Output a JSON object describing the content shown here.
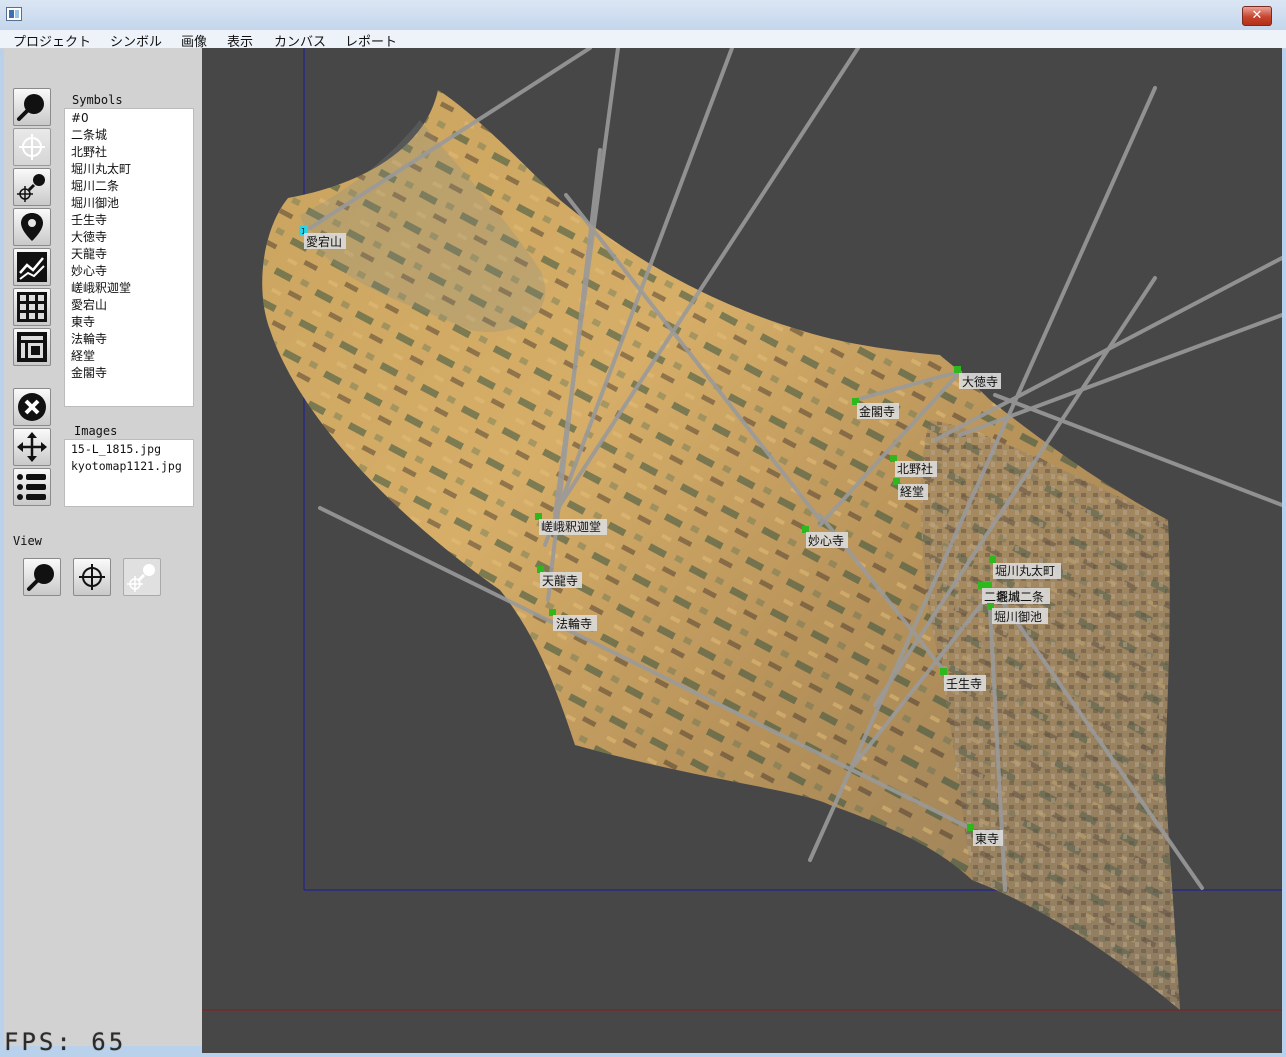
{
  "window": {
    "close_glyph": "✕"
  },
  "menu": [
    "プロジェクト",
    "シンボル",
    "画像",
    "表示",
    "カンバス",
    "レポート"
  ],
  "toolbar": {
    "tools": [
      "search-tool",
      "crosshair-tool",
      "crosshair-search-tool",
      "map-pin-tool",
      "chart-tool",
      "grid-tool",
      "layout-tool",
      "delete-tool",
      "move-tool",
      "list-tool"
    ],
    "active": "crosshair-tool"
  },
  "symbols": {
    "title": "Symbols",
    "items": [
      "#0",
      "二条城",
      "北野社",
      "堀川丸太町",
      "堀川二条",
      "堀川御池",
      "壬生寺",
      "大徳寺",
      "天龍寺",
      "妙心寺",
      "嵯峨釈迦堂",
      "愛宕山",
      "東寺",
      "法輪寺",
      "経堂",
      "金閣寺"
    ]
  },
  "images": {
    "title": "Images",
    "items": [
      "15-L_1815.jpg",
      "kyotomap1121.jpg"
    ]
  },
  "view": {
    "title": "View",
    "buttons": [
      "search-view",
      "crosshair-view",
      "crosshair-search-view"
    ],
    "disabled": "crosshair-search-view"
  },
  "canvas_labels": [
    "愛宕山",
    "大徳寺",
    "金閣寺",
    "北野社",
    "経堂",
    "嵯峨釈迦堂",
    "妙心寺",
    "堀川丸太町",
    "二条城",
    "堀川二条",
    "堀川御池",
    "天龍寺",
    "法輪寺",
    "壬生寺",
    "東寺"
  ],
  "selected_marker": "1",
  "fps": "FPS: 65",
  "colors": {
    "canvas_bg": "#474747",
    "marker": "#2fb81e",
    "selected_marker": "#29d4e8",
    "frame_line": "#1a1aa0",
    "baseline": "#8a1c1c",
    "ray": "#9a9a9a"
  }
}
